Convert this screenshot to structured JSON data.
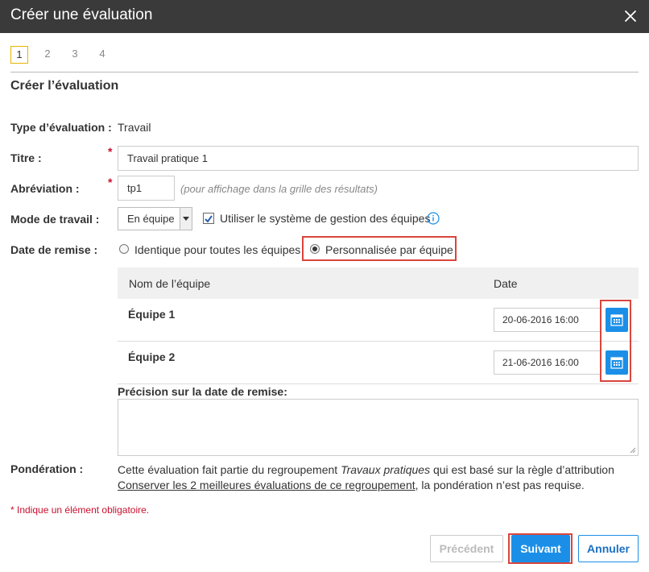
{
  "dialog": {
    "title": "Créer une évaluation"
  },
  "steps": [
    "1",
    "2",
    "3",
    "4"
  ],
  "section_title": "Créer l’évaluation",
  "form": {
    "type_label": "Type d’évaluation :",
    "type_value": "Travail",
    "title_label": "Titre :",
    "title_value": "Travail pratique 1",
    "abbrev_label": "Abréviation :",
    "abbrev_value": "tp1",
    "abbrev_hint": "(pour affichage dans la grille des résultats)",
    "required_mark": "*",
    "mode_label": "Mode de travail :",
    "mode_value": "En équipe",
    "team_system_label": "Utiliser le système de gestion des équipes",
    "team_system_checked": true,
    "due_label": "Date de remise :",
    "due_option_same": "Identique pour toutes les équipes",
    "due_option_custom": "Personnalisée par équipe",
    "due_selected": "custom"
  },
  "team_table": {
    "headers": [
      "Nom de l’équipe",
      "Date"
    ],
    "rows": [
      {
        "name": "Équipe 1",
        "date": "20-06-2016 16:00"
      },
      {
        "name": "Équipe 2",
        "date": "21-06-2016 16:00"
      }
    ]
  },
  "precision": {
    "label": "Précision sur la date de remise:",
    "value": ""
  },
  "weighting": {
    "label": "Pondération :",
    "text_1": "Cette évaluation fait partie du regroupement ",
    "group_name": "Travaux pratiques",
    "text_2": " qui est basé sur la règle d’attribution ",
    "rule_link": "Conserver les 2 meilleures évaluations de ce regroupement",
    "text_3": ", la pondération n’est pas requise."
  },
  "required_note": "* Indique un élément obligatoire.",
  "buttons": {
    "previous": "Précédent",
    "next": "Suivant",
    "cancel": "Annuler"
  },
  "colors": {
    "titlebar": "#3a3a3a",
    "accent": "#1b8fe8",
    "required": "#c8102e",
    "highlight": "#d9453d",
    "step_active": "#e8b400"
  },
  "icons": {
    "close": "close-icon",
    "info": "info-icon",
    "calendar": "calendar-icon"
  }
}
